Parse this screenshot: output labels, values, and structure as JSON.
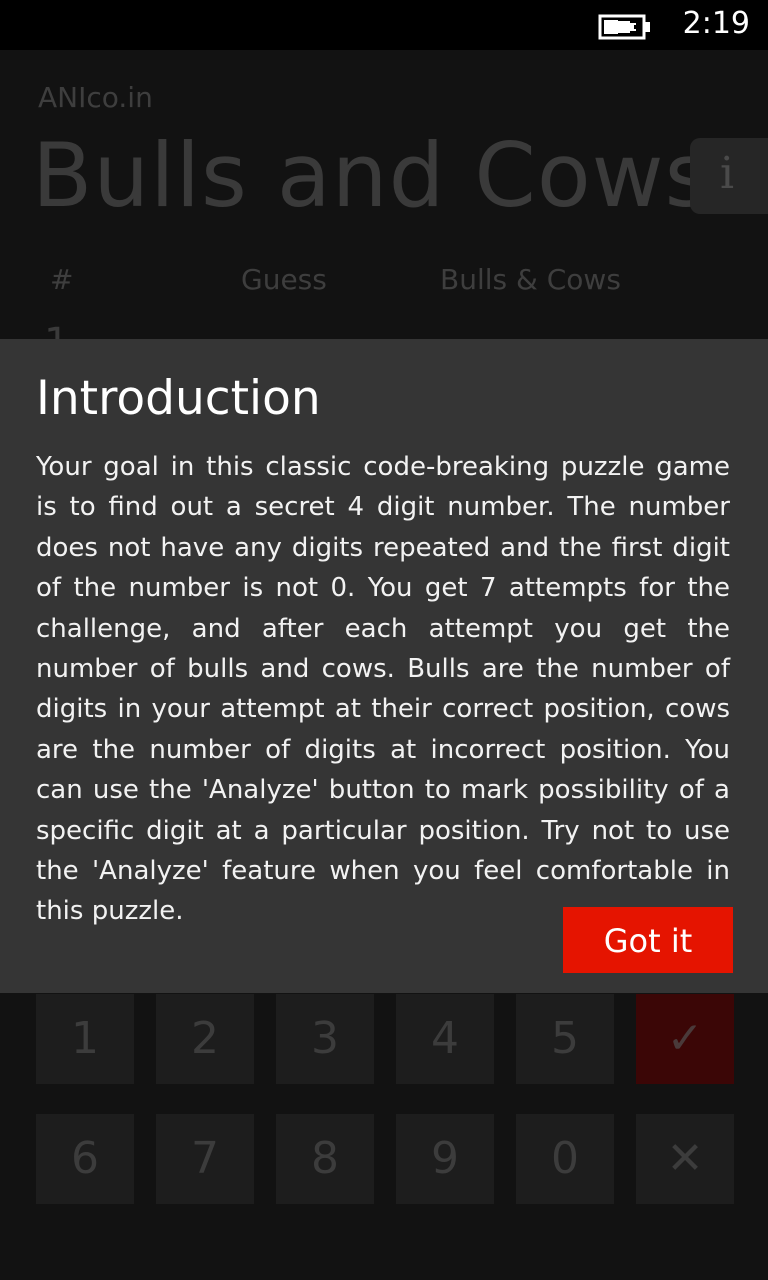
{
  "status_bar": {
    "time": "2:19",
    "battery_icon": "battery-charging-icon"
  },
  "app": {
    "publisher": "ANIco.in",
    "title": "Bulls and Cows",
    "info_label": "i",
    "table_headers": {
      "number": "#",
      "guess": "Guess",
      "result": "Bulls & Cows"
    },
    "first_row_number": "1",
    "keypad": {
      "row1": [
        "1",
        "2",
        "3",
        "4",
        "5",
        "✓"
      ],
      "row2": [
        "6",
        "7",
        "8",
        "9",
        "0",
        "✕"
      ]
    }
  },
  "dialog": {
    "heading": "Introduction",
    "body": "Your goal in this classic code-breaking puzzle game is to find out a secret 4 digit number. The number does not have any digits repeated and the first digit of the number is not 0. You get 7 attempts for the challenge, and after each attempt you get the number of bulls and cows. Bulls are the number of digits in your attempt at their correct position, cows are the number of digits at incorrect position. You can use the 'Analyze' button to mark possibility of a specific digit at a particular position. Try not to use the 'Analyze' feature when you feel comfortable in this puzzle.",
    "button_label": "Got it"
  },
  "colors": {
    "accent": "#e51400",
    "dialog_background": "#353535"
  }
}
